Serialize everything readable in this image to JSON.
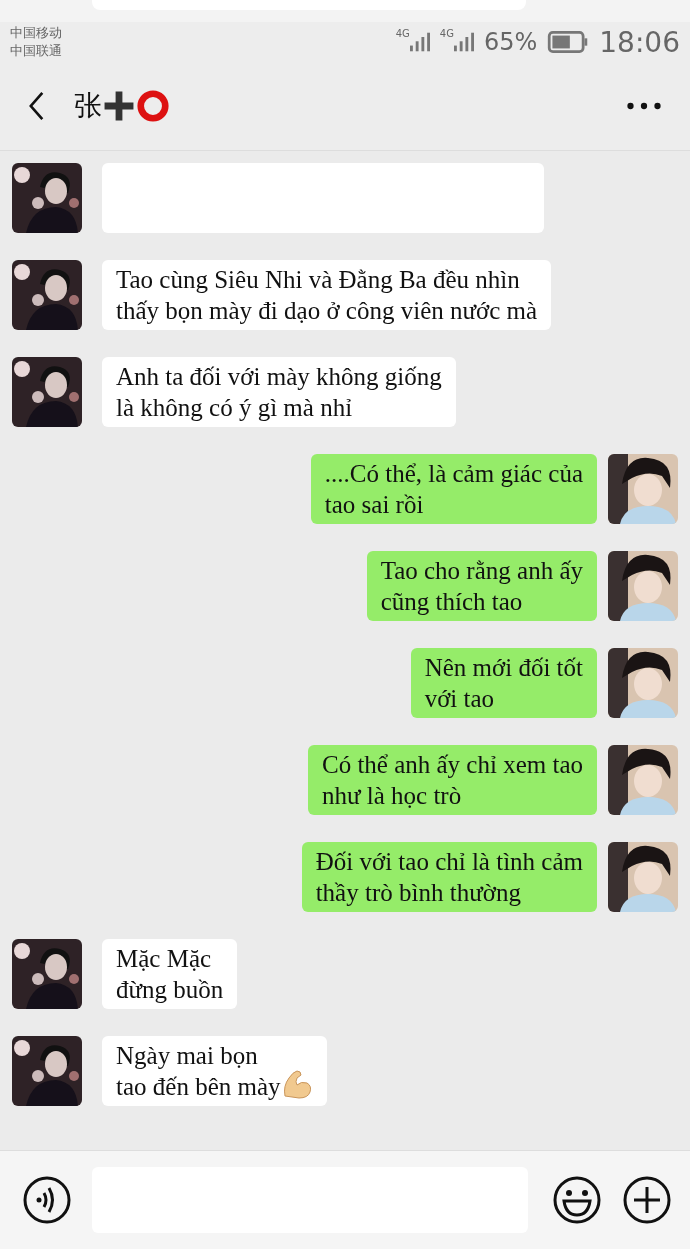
{
  "status_bar": {
    "carriers": [
      "中国移动",
      "中国联通"
    ],
    "networks": [
      "4G",
      "4G"
    ],
    "battery": "65%",
    "time": "18:06"
  },
  "header": {
    "title": "张"
  },
  "messages": [
    {
      "kind": "incoming"
    },
    {
      "kind": "incoming",
      "text": "Tao cùng Siêu Nhi và Đằng Ba đều nhìn\nthấy bọn mày đi dạo ở công viên nước mà"
    },
    {
      "kind": "incoming",
      "text": "Anh ta đối với mày không giống\nlà không có ý gì mà nhỉ"
    },
    {
      "kind": "outgoing",
      "text": "....Có thể, là cảm giác của\ntao sai rồi"
    },
    {
      "kind": "outgoing",
      "text": "Tao cho rằng anh ấy\ncũng thích tao"
    },
    {
      "kind": "outgoing",
      "text": "Nên mới đối tốt\nvới tao"
    },
    {
      "kind": "outgoing",
      "text": "Có thể anh ấy chỉ xem tao\nnhư là học trò"
    },
    {
      "kind": "outgoing",
      "text": "Đối với tao chỉ là tình cảm\nthầy trò bình thường"
    },
    {
      "kind": "incoming",
      "text": "Mặc Mặc\nđừng buồn"
    },
    {
      "kind": "incoming",
      "text": "Ngày mai bọn\ntao đến bên mày",
      "has_emoji": true
    }
  ]
}
